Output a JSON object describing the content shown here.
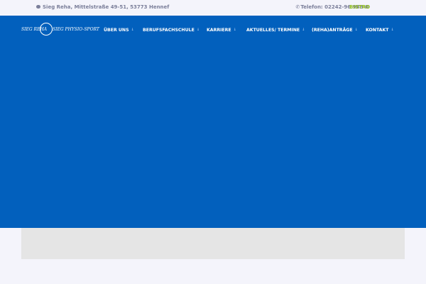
{
  "topbar": {
    "address": "Sieg Reha, Mittelstraße 49-51, 53773 Hennef",
    "phone": "Telefon: 02242-96 988-0",
    "bistro": "BISTRO",
    "bistro_color": "#8fbf1a",
    "chat_icon": "chat-icon",
    "phone_icon": "phone-icon"
  },
  "logo": {
    "left_text": "SIEG REHA",
    "right_text": "SIEG PHYSIO-SPORT"
  },
  "nav": {
    "items": [
      {
        "label": "ÜBER UNS"
      },
      {
        "label": "BERUFSFACHSCHULE"
      },
      {
        "label": "KARRIERE"
      },
      {
        "label": "AKTUELLES/ TERMINE"
      },
      {
        "label": "(REHA)ANTRÄGE"
      },
      {
        "label": "KONTAKT"
      }
    ],
    "arrow_icon": "arrow-down-icon"
  },
  "colors": {
    "hero_bg": "#0260bd",
    "page_bg": "#f4f4fb",
    "content_bg": "#e5e5e5"
  }
}
